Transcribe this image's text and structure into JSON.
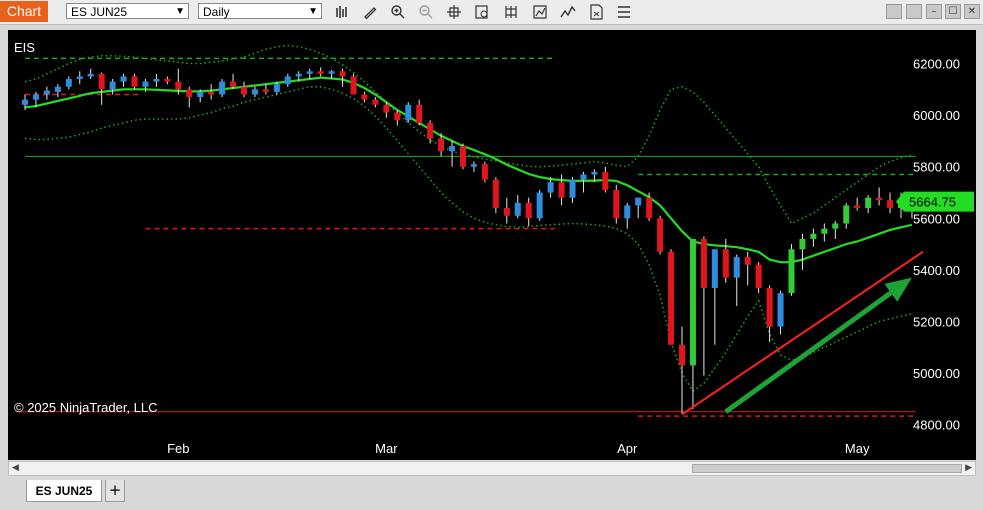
{
  "toolbar": {
    "chart_label": "Chart",
    "instrument": "ES JUN25",
    "interval": "Daily"
  },
  "tabs": {
    "active": "ES JUN25",
    "add": "+"
  },
  "chart_data": {
    "type": "candlestick",
    "symbol_label": "EIS",
    "copyright": "© 2025 NinjaTrader, LLC",
    "last_price_label": "5664.75",
    "ylim": [
      4760,
      6330
    ],
    "y_ticks": [
      "6200.00",
      "6000.00",
      "5800.00",
      "5600.00",
      "5400.00",
      "5200.00",
      "5000.00",
      "4800.00"
    ],
    "x_ticks": [
      {
        "label": "Feb",
        "index": 14
      },
      {
        "label": "Mar",
        "index": 33
      },
      {
        "label": "Apr",
        "index": 55
      },
      {
        "label": "May",
        "index": 76
      }
    ],
    "colors": {
      "up_candle": "#2f8de0",
      "down_candle": "#e0161c",
      "up_candle_strong": "#33cc33",
      "sma": "#22dd22",
      "bollinger": "#1fa81f",
      "level_green": "#1fa81f",
      "level_red": "#e0161c",
      "trendline": "#ff2020",
      "arrow": "#1ea336",
      "price_tag": "#22dd22"
    },
    "candles": [
      [
        6040,
        6080,
        6020,
        6060
      ],
      [
        6060,
        6090,
        6030,
        6080
      ],
      [
        6080,
        6110,
        6060,
        6095
      ],
      [
        6090,
        6120,
        6070,
        6110
      ],
      [
        6110,
        6150,
        6100,
        6140
      ],
      [
        6140,
        6170,
        6120,
        6150
      ],
      [
        6150,
        6180,
        6140,
        6160
      ],
      [
        6160,
        6165,
        6040,
        6100
      ],
      [
        6100,
        6140,
        6080,
        6130
      ],
      [
        6130,
        6160,
        6110,
        6150
      ],
      [
        6150,
        6160,
        6100,
        6110
      ],
      [
        6110,
        6140,
        6090,
        6130
      ],
      [
        6130,
        6160,
        6110,
        6140
      ],
      [
        6140,
        6150,
        6120,
        6130
      ],
      [
        6130,
        6180,
        6080,
        6100
      ],
      [
        6100,
        6110,
        6030,
        6070
      ],
      [
        6070,
        6100,
        6050,
        6090
      ],
      [
        6090,
        6120,
        6060,
        6080
      ],
      [
        6080,
        6140,
        6070,
        6130
      ],
      [
        6130,
        6160,
        6100,
        6110
      ],
      [
        6110,
        6130,
        6070,
        6080
      ],
      [
        6080,
        6110,
        6070,
        6100
      ],
      [
        6100,
        6120,
        6080,
        6090
      ],
      [
        6090,
        6130,
        6080,
        6120
      ],
      [
        6120,
        6160,
        6110,
        6150
      ],
      [
        6150,
        6170,
        6130,
        6160
      ],
      [
        6160,
        6180,
        6140,
        6170
      ],
      [
        6170,
        6185,
        6150,
        6160
      ],
      [
        6160,
        6175,
        6140,
        6170
      ],
      [
        6170,
        6180,
        6110,
        6150
      ],
      [
        6150,
        6160,
        6090,
        6080
      ],
      [
        6080,
        6090,
        6050,
        6060
      ],
      [
        6060,
        6070,
        6030,
        6040
      ],
      [
        6040,
        6050,
        5990,
        6010
      ],
      [
        6010,
        6020,
        5960,
        5980
      ],
      [
        5980,
        6050,
        5970,
        6040
      ],
      [
        6040,
        6060,
        5960,
        5970
      ],
      [
        5970,
        5980,
        5890,
        5910
      ],
      [
        5910,
        5930,
        5840,
        5860
      ],
      [
        5860,
        5900,
        5800,
        5880
      ],
      [
        5880,
        5890,
        5790,
        5800
      ],
      [
        5800,
        5820,
        5780,
        5810
      ],
      [
        5810,
        5820,
        5740,
        5750
      ],
      [
        5750,
        5760,
        5620,
        5640
      ],
      [
        5640,
        5680,
        5580,
        5610
      ],
      [
        5610,
        5690,
        5600,
        5660
      ],
      [
        5660,
        5680,
        5570,
        5600
      ],
      [
        5600,
        5710,
        5590,
        5700
      ],
      [
        5700,
        5760,
        5680,
        5740
      ],
      [
        5740,
        5770,
        5650,
        5680
      ],
      [
        5680,
        5760,
        5660,
        5750
      ],
      [
        5750,
        5780,
        5700,
        5770
      ],
      [
        5770,
        5790,
        5740,
        5780
      ],
      [
        5780,
        5800,
        5700,
        5710
      ],
      [
        5710,
        5730,
        5580,
        5600
      ],
      [
        5600,
        5660,
        5560,
        5650
      ],
      [
        5650,
        5680,
        5600,
        5680
      ],
      [
        5680,
        5700,
        5590,
        5600
      ],
      [
        5600,
        5610,
        5460,
        5470
      ],
      [
        5470,
        5480,
        5110,
        5110
      ],
      [
        5110,
        5180,
        4840,
        5030
      ],
      [
        5030,
        5300,
        4860,
        5520
      ],
      [
        5520,
        5530,
        4990,
        5330
      ],
      [
        5330,
        5480,
        5110,
        5480
      ],
      [
        5480,
        5520,
        5350,
        5370
      ],
      [
        5370,
        5460,
        5260,
        5450
      ],
      [
        5450,
        5470,
        5340,
        5420
      ],
      [
        5420,
        5430,
        5310,
        5330
      ],
      [
        5330,
        5340,
        5120,
        5180
      ],
      [
        5180,
        5320,
        5150,
        5310
      ],
      [
        5310,
        5500,
        5300,
        5480
      ],
      [
        5480,
        5540,
        5400,
        5520
      ],
      [
        5520,
        5560,
        5490,
        5540
      ],
      [
        5540,
        5580,
        5510,
        5560
      ],
      [
        5560,
        5590,
        5520,
        5580
      ],
      [
        5580,
        5660,
        5560,
        5650
      ],
      [
        5650,
        5680,
        5630,
        5640
      ],
      [
        5640,
        5690,
        5620,
        5680
      ],
      [
        5680,
        5720,
        5650,
        5670
      ],
      [
        5670,
        5700,
        5620,
        5640
      ],
      [
        5640,
        5700,
        5600,
        5670
      ],
      [
        5670,
        5690,
        5600,
        5664.75
      ]
    ],
    "sma": [
      6030,
      6035,
      6045,
      6055,
      6065,
      6075,
      6085,
      6090,
      6095,
      6100,
      6100,
      6100,
      6098,
      6096,
      6094,
      6092,
      6092,
      6095,
      6100,
      6105,
      6110,
      6115,
      6120,
      6125,
      6130,
      6135,
      6140,
      6145,
      6142,
      6138,
      6125,
      6105,
      6080,
      6050,
      6020,
      5995,
      5970,
      5945,
      5920,
      5900,
      5880,
      5865,
      5848,
      5830,
      5808,
      5790,
      5772,
      5760,
      5752,
      5748,
      5745,
      5745,
      5746,
      5748,
      5745,
      5728,
      5705,
      5682,
      5650,
      5600,
      5550,
      5510,
      5500,
      5495,
      5492,
      5488,
      5480,
      5470,
      5440,
      5430,
      5430,
      5440,
      5455,
      5470,
      5485,
      5500,
      5510,
      5525,
      5540,
      5555,
      5565,
      5575
    ],
    "boll_upper": [
      6130,
      6140,
      6160,
      6180,
      6200,
      6215,
      6225,
      6230,
      6230,
      6228,
      6225,
      6220,
      6215,
      6210,
      6205,
      6200,
      6200,
      6205,
      6210,
      6218,
      6225,
      6240,
      6255,
      6265,
      6270,
      6265,
      6255,
      6240,
      6220,
      6195,
      6165,
      6130,
      6090,
      6050,
      6010,
      5970,
      5935,
      5905,
      5880,
      5860,
      5848,
      5838,
      5830,
      5822,
      5815,
      5808,
      5802,
      5800,
      5802,
      5806,
      5810,
      5815,
      5820,
      5815,
      5805,
      5800,
      5840,
      5920,
      6020,
      6100,
      6110,
      6090,
      6050,
      6000,
      5950,
      5900,
      5850,
      5800,
      5720,
      5650,
      5580,
      5600,
      5620,
      5650,
      5680,
      5710,
      5740,
      5770,
      5800,
      5820,
      5835,
      5845
    ],
    "boll_lower": [
      5910,
      5905,
      5905,
      5910,
      5915,
      5925,
      5935,
      5950,
      5960,
      5970,
      5980,
      5985,
      5985,
      5985,
      5985,
      5990,
      6000,
      6010,
      6025,
      6035,
      6050,
      6060,
      6070,
      6080,
      6090,
      6100,
      6110,
      6110,
      6100,
      6085,
      6065,
      6035,
      5995,
      5950,
      5900,
      5850,
      5800,
      5750,
      5700,
      5660,
      5625,
      5600,
      5585,
      5575,
      5568,
      5565,
      5568,
      5572,
      5575,
      5578,
      5580,
      5578,
      5575,
      5570,
      5560,
      5540,
      5500,
      5420,
      5300,
      5120,
      5000,
      4930,
      4960,
      5020,
      5080,
      5150,
      5220,
      5280,
      5150,
      5070,
      5050,
      5060,
      5080,
      5100,
      5120,
      5140,
      5160,
      5180,
      5200,
      5210,
      5220,
      5230
    ],
    "levels": [
      {
        "value": 6220,
        "style": "dashed",
        "color": "green",
        "from": 0,
        "to": 48
      },
      {
        "value": 6080,
        "style": "dashed",
        "color": "red",
        "from": 0,
        "to": 10
      },
      {
        "value": 5840,
        "style": "solid",
        "color": "green",
        "from": 0,
        "to": 81
      },
      {
        "value": 5770,
        "style": "dashed",
        "color": "green",
        "from": 56,
        "to": 81
      },
      {
        "value": 5560,
        "style": "dashed",
        "color": "red",
        "from": 11,
        "to": 48
      },
      {
        "value": 4833,
        "style": "dashed",
        "color": "red",
        "from": 56,
        "to": 81
      },
      {
        "value": 4850,
        "style": "solid",
        "color": "red",
        "from": -1,
        "to": 81
      }
    ],
    "trendline": [
      [
        60,
        4840
      ],
      [
        82,
        5470
      ]
    ],
    "arrow": [
      [
        64,
        4850
      ],
      [
        81,
        5370
      ]
    ]
  }
}
